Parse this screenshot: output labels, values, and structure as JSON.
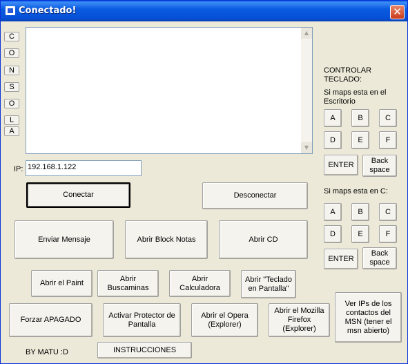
{
  "window": {
    "title": "Conectado!",
    "close_label": "✕"
  },
  "side_buttons": [
    "C",
    "O",
    "N",
    "S",
    "O",
    "L",
    "A"
  ],
  "ip": {
    "label": "IP:",
    "value": "192.168.1.122"
  },
  "buttons": {
    "conectar": "Conectar",
    "desconectar": "Desconectar",
    "enviar_mensaje": "Enviar Mensaje",
    "abrir_block_notas": "Abrir Block Notas",
    "abrir_cd": "Abrir CD",
    "abrir_paint": "Abrir el Paint",
    "abrir_buscaminas": "Abrir Buscaminas",
    "abrir_calculadora": "Abrir Calculadora",
    "abrir_teclado": "Abrir \"Teclado en Pantalla\"",
    "forzar_apagado": "Forzar APAGADO",
    "activar_protector": "Activar Protector de Pantalla",
    "abrir_opera": "Abrir el Opera (Explorer)",
    "abrir_firefox": "Abrir el Mozilla Firefox (Explorer)",
    "ver_ips": "Ver IPs de los contactos del MSN (tener el msn abierto)",
    "instrucciones": "INSTRUCCIONES"
  },
  "keyboard": {
    "title": "CONTROLAR TECLADO:",
    "desktop_label": "Si maps esta en el Escritorio",
    "c_label": "Si maps esta en C:",
    "keys": [
      "A",
      "B",
      "C",
      "D",
      "E",
      "F"
    ],
    "enter": "ENTER",
    "backspace": "Back space"
  },
  "footer": {
    "credit": "BY MATU :D"
  }
}
